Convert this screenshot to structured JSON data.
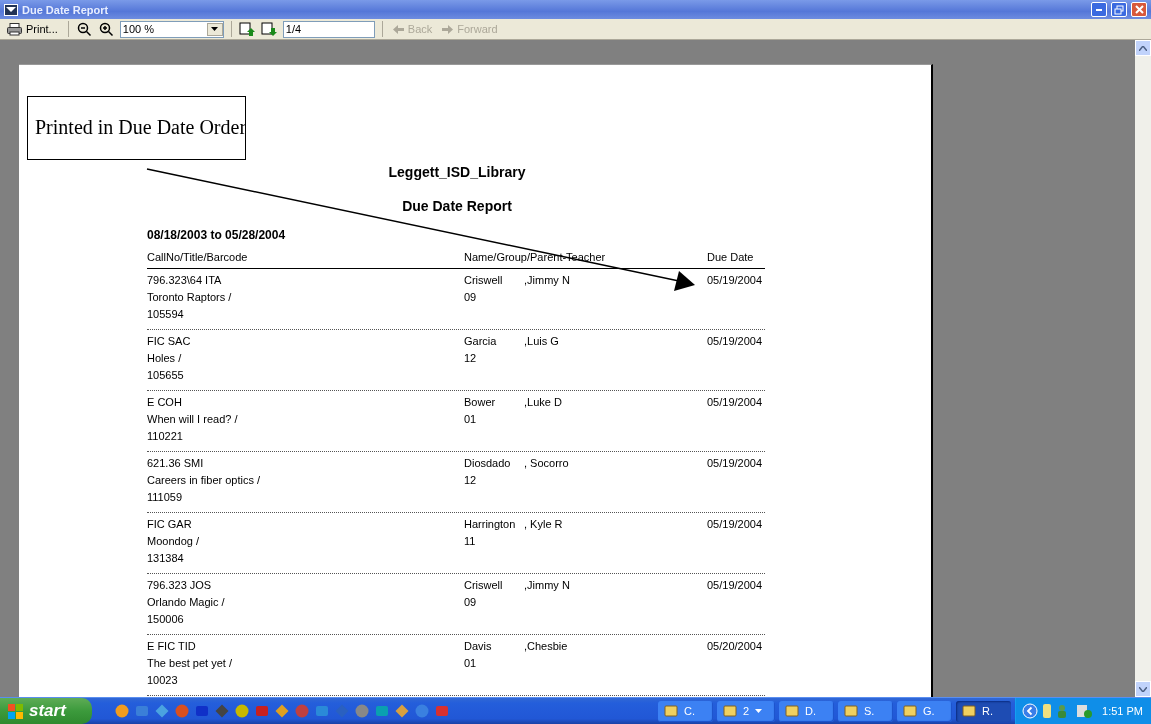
{
  "window": {
    "title": "Due Date Report"
  },
  "toolbar": {
    "print": "Print...",
    "zoom": "100 %",
    "page": "1/4",
    "back": {
      "label": "Back",
      "disabled": true
    },
    "forward": {
      "label": "Forward",
      "disabled": true
    }
  },
  "annotation": "Printed in Due Date Order",
  "report": {
    "organization": "Leggett_ISD_Library",
    "title": "Due Date Report",
    "date_range": "08/18/2003 to 05/28/2004",
    "columns": [
      "CallNo/Title/Barcode",
      "Name/Group/Parent-Teacher",
      "Due Date"
    ],
    "rows": [
      {
        "call_no": "796.323\\64 ITA",
        "title": "Toronto Raptors /",
        "barcode": "105594",
        "last_name": "Criswell",
        "first_name": ",Jimmy N",
        "group": "09",
        "due_date": "05/19/2004"
      },
      {
        "call_no": "FIC SAC",
        "title": "Holes /",
        "barcode": "105655",
        "last_name": "Garcia",
        "first_name": ",Luis G",
        "group": "12",
        "due_date": "05/19/2004"
      },
      {
        "call_no": "E COH",
        "title": "When will I read? /",
        "barcode": "110221",
        "last_name": "Bower",
        "first_name": ",Luke D",
        "group": "01",
        "due_date": "05/19/2004"
      },
      {
        "call_no": "621.36 SMI",
        "title": "Careers in fiber optics /",
        "barcode": "111059",
        "last_name": "Diosdado",
        "first_name": ", Socorro",
        "group": "12",
        "due_date": "05/19/2004"
      },
      {
        "call_no": "FIC GAR",
        "title": "Moondog /",
        "barcode": "131384",
        "last_name": "Harrington",
        "first_name": ", Kyle R",
        "group": "11",
        "due_date": "05/19/2004"
      },
      {
        "call_no": "796.323 JOS",
        "title": "Orlando Magic /",
        "barcode": "150006",
        "last_name": "Criswell",
        "first_name": ",Jimmy N",
        "group": "09",
        "due_date": "05/19/2004"
      },
      {
        "call_no": "E FIC TID",
        "title": "The best pet yet /",
        "barcode": "10023",
        "last_name": "Davis",
        "first_name": ",Chesbie",
        "group": "01",
        "due_date": "05/20/2004"
      }
    ]
  },
  "taskbar": {
    "start": "start",
    "tasks": [
      {
        "label": "C.",
        "selected": false,
        "has_menu": false
      },
      {
        "label": "2",
        "selected": false,
        "has_menu": true
      },
      {
        "label": "D.",
        "selected": false,
        "has_menu": false
      },
      {
        "label": "S.",
        "selected": false,
        "has_menu": false
      },
      {
        "label": "G.",
        "selected": false,
        "has_menu": false
      },
      {
        "label": "R.",
        "selected": true,
        "has_menu": false
      }
    ],
    "clock": "1:51 PM"
  }
}
